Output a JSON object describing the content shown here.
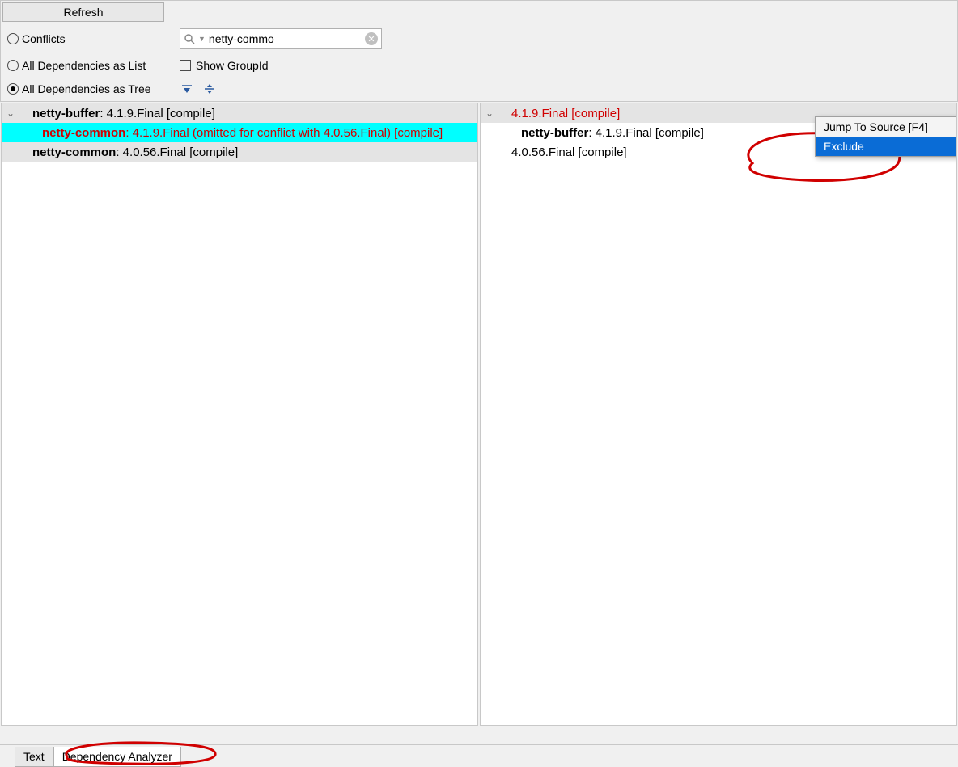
{
  "toolbar": {
    "refresh_label": "Refresh"
  },
  "filters": {
    "conflicts_label": "Conflicts",
    "all_list_label": "All Dependencies as List",
    "all_tree_label": "All Dependencies as Tree",
    "show_groupid_label": "Show GroupId",
    "search_value": "netty-commo"
  },
  "left_tree": {
    "root": {
      "name": "netty-buffer",
      "detail": " : 4.1.9.Final [compile]"
    },
    "child1": {
      "name": "netty-common",
      "detail": " : 4.1.9.Final (omitted for conflict with 4.0.56.Final) [compile]"
    },
    "child2": {
      "name": "netty-common",
      "detail": " : 4.0.56.Final [compile]"
    }
  },
  "right_tree": {
    "root": {
      "text": "4.1.9.Final [compile]"
    },
    "child1": {
      "name": "netty-buffer",
      "detail": " : 4.1.9.Final [compile]"
    },
    "child2": {
      "text": "4.0.56.Final [compile]"
    }
  },
  "context_menu": {
    "jump_label": "Jump To Source [F4]",
    "exclude_label": "Exclude"
  },
  "tabs": {
    "text_label": "Text",
    "analyzer_label": "Dependency Analyzer"
  }
}
